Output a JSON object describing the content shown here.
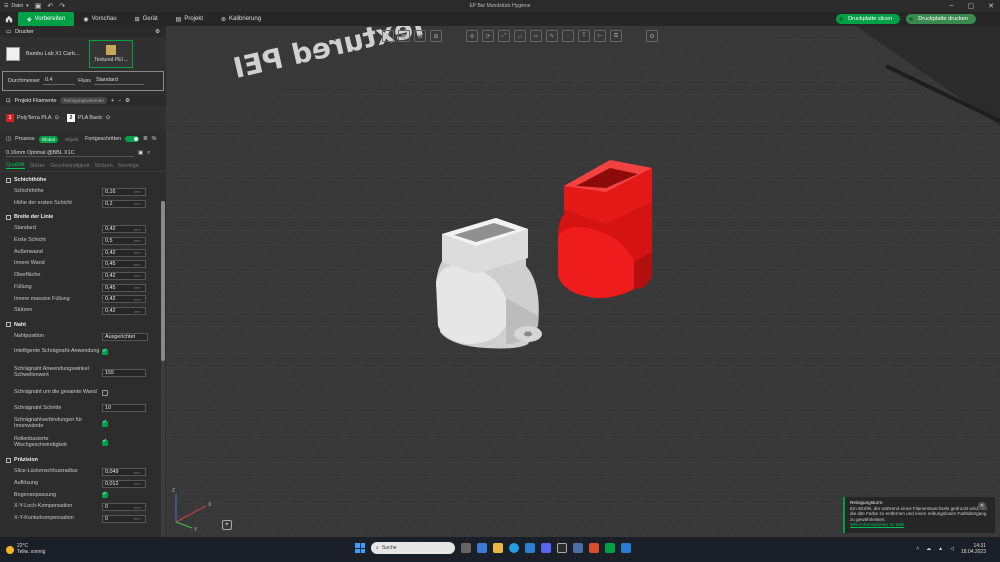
{
  "window": {
    "file_menu": "Datei",
    "title": "EP Bar Mundstück Hygiene"
  },
  "tabs": [
    {
      "label": "Vorbereiten"
    },
    {
      "label": "Vorschau"
    },
    {
      "label": "Gerät"
    },
    {
      "label": "Projekt"
    },
    {
      "label": "Kalibrierung"
    }
  ],
  "actions": {
    "slice": "Druckplatte slicen",
    "print": "Druckplatte drucken"
  },
  "printer": {
    "section": "Drucker",
    "name": "Bambu Lab X1 Carb...",
    "plate": "Textured PEI ...",
    "diameter_label": "Durchmesser",
    "diameter_value": "0.4",
    "flow_label": "Fluss",
    "flow_value": "Standard"
  },
  "filaments": {
    "section": "Projekt Filamente",
    "badge": "Reinigungsvolumen",
    "items": [
      {
        "num": "1",
        "name": "PolyTerra PLA",
        "color": "#d42020"
      },
      {
        "num": "2",
        "name": "PLA Basic",
        "color": "#ffffff"
      }
    ]
  },
  "process": {
    "section": "Prozess",
    "global": "Global",
    "objects": "Objekt",
    "advanced": "Fortgeschritten",
    "preset": "0.16mm Optimal @BBL X1C"
  },
  "subtabs": [
    "Qualität",
    "Stärke",
    "Geschwindigkeit",
    "Stützen",
    "Sonstige"
  ],
  "groups": {
    "layer": {
      "title": "Schichthöhe",
      "params": [
        {
          "label": "Schichthöhe",
          "value": "0,16",
          "unit": "mm"
        },
        {
          "label": "Höhe der ersten Schicht",
          "value": "0,2",
          "unit": "mm"
        }
      ]
    },
    "width": {
      "title": "Breite der Linie",
      "params": [
        {
          "label": "Standard",
          "value": "0,42",
          "unit": "mm"
        },
        {
          "label": "Erste Schicht",
          "value": "0,5",
          "unit": "mm"
        },
        {
          "label": "Außenwand",
          "value": "0,42",
          "unit": "mm"
        },
        {
          "label": "Innere Wand",
          "value": "0,45",
          "unit": "mm"
        },
        {
          "label": "Oberfläche",
          "value": "0,42",
          "unit": "mm"
        },
        {
          "label": "Füllung",
          "value": "0,45",
          "unit": "mm"
        },
        {
          "label": "Innere massive Füllung",
          "value": "0,42",
          "unit": "mm"
        },
        {
          "label": "Stützen",
          "value": "0,42",
          "unit": "mm"
        }
      ]
    },
    "seam": {
      "title": "Naht",
      "position_label": "Nahtposition",
      "position_value": "Ausgerichtet",
      "smart_label": "Intelligente Schrägnaht-Anwendung",
      "threshold_label": "Schrägnaht Anwendungswinkel Schwellenwert",
      "threshold_value": "155",
      "whole_wall_label": "Schrägnaht um die gesamte Wand",
      "steps_label": "Schrägnaht Schritte",
      "steps_value": "10",
      "inner_label": "Schrägnahtverbindungen für Innenwände",
      "roll_label": "Rollenbasierte Wischgeschwindigkeit"
    },
    "precision": {
      "title": "Präzision",
      "params": [
        {
          "label": "Slice-Lückenschlussradius",
          "value": "0,049",
          "unit": "mm"
        },
        {
          "label": "Auflösung",
          "value": "0,012",
          "unit": "mm"
        }
      ],
      "arc_label": "Bogenanpassung",
      "xy_hole_label": "X-Y-Loch-Kompensation",
      "xy_hole_value": "0",
      "xy_contour_label": "X-Y-Konturkompensation",
      "xy_contour_value": "0",
      "unit": "mm"
    }
  },
  "viewport": {
    "bed_text": "Textured PEI",
    "axis_x": "X",
    "axis_y": "Y",
    "axis_z": "Z",
    "left_object_color": "#d9d9d9",
    "right_object_color": "#e01010"
  },
  "notification": {
    "title": "Reinigungsturm:",
    "body": "Ein Würfel, der während eines Filamentwechsels gedruckt wird, um die alte Farbe zu entfernen und einen reibungslosen Farbübergang zu gewährleisten.",
    "link": "Wiki Informationen zu Wiki"
  },
  "taskbar": {
    "temp": "22°C",
    "weather": "Teilw. sonnig",
    "search": "Suche",
    "time": "14:31",
    "date": "18.04.2023"
  }
}
